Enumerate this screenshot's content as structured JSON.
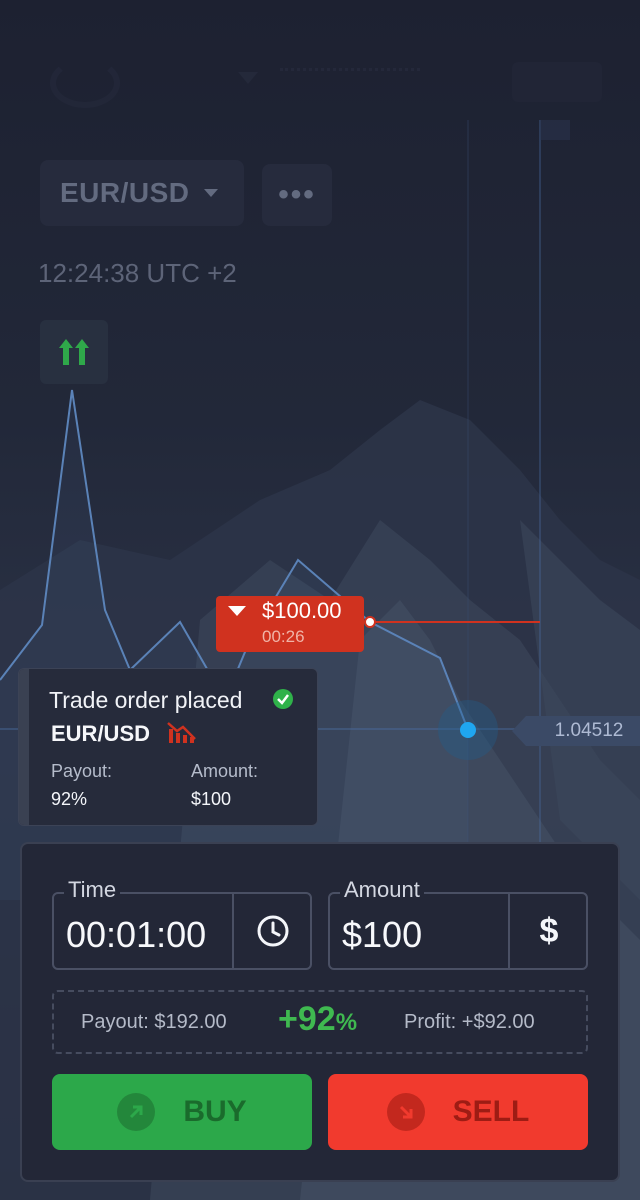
{
  "header": {
    "pair_selector": "EUR/USD",
    "more_label": "•••",
    "clock": "12:24:38 UTC +2"
  },
  "chart": {
    "open_trade": {
      "amount": "$100.00",
      "time_left": "00:26"
    },
    "current_price": "1.04512",
    "colors": {
      "line": "#5b83b8",
      "trade": "#d0321f",
      "price_dot": "#1fa6f0"
    }
  },
  "notification": {
    "title": "Trade order placed",
    "pair": "EUR/USD",
    "payout_label": "Payout:",
    "payout_value": "92%",
    "amount_label": "Amount:",
    "amount_value": "$100"
  },
  "panel": {
    "time_label": "Time",
    "time_value": "00:01:00",
    "amount_label": "Amount",
    "amount_value": "$100",
    "currency_symbol": "$",
    "payout_text": "Payout: $192.00",
    "payout_pct": "+92",
    "payout_pct_sign": "%",
    "profit_text": "Profit: +$92.00",
    "buy_label": "BUY",
    "sell_label": "SELL",
    "colors": {
      "buy": "#2ca84a",
      "sell": "#f13a2e"
    }
  },
  "icons": [
    "clock-icon",
    "dollar-icon",
    "arrow-up-right-icon",
    "arrow-down-right-icon",
    "check-icon",
    "double-arrow-up-icon",
    "downtrend-icon"
  ]
}
